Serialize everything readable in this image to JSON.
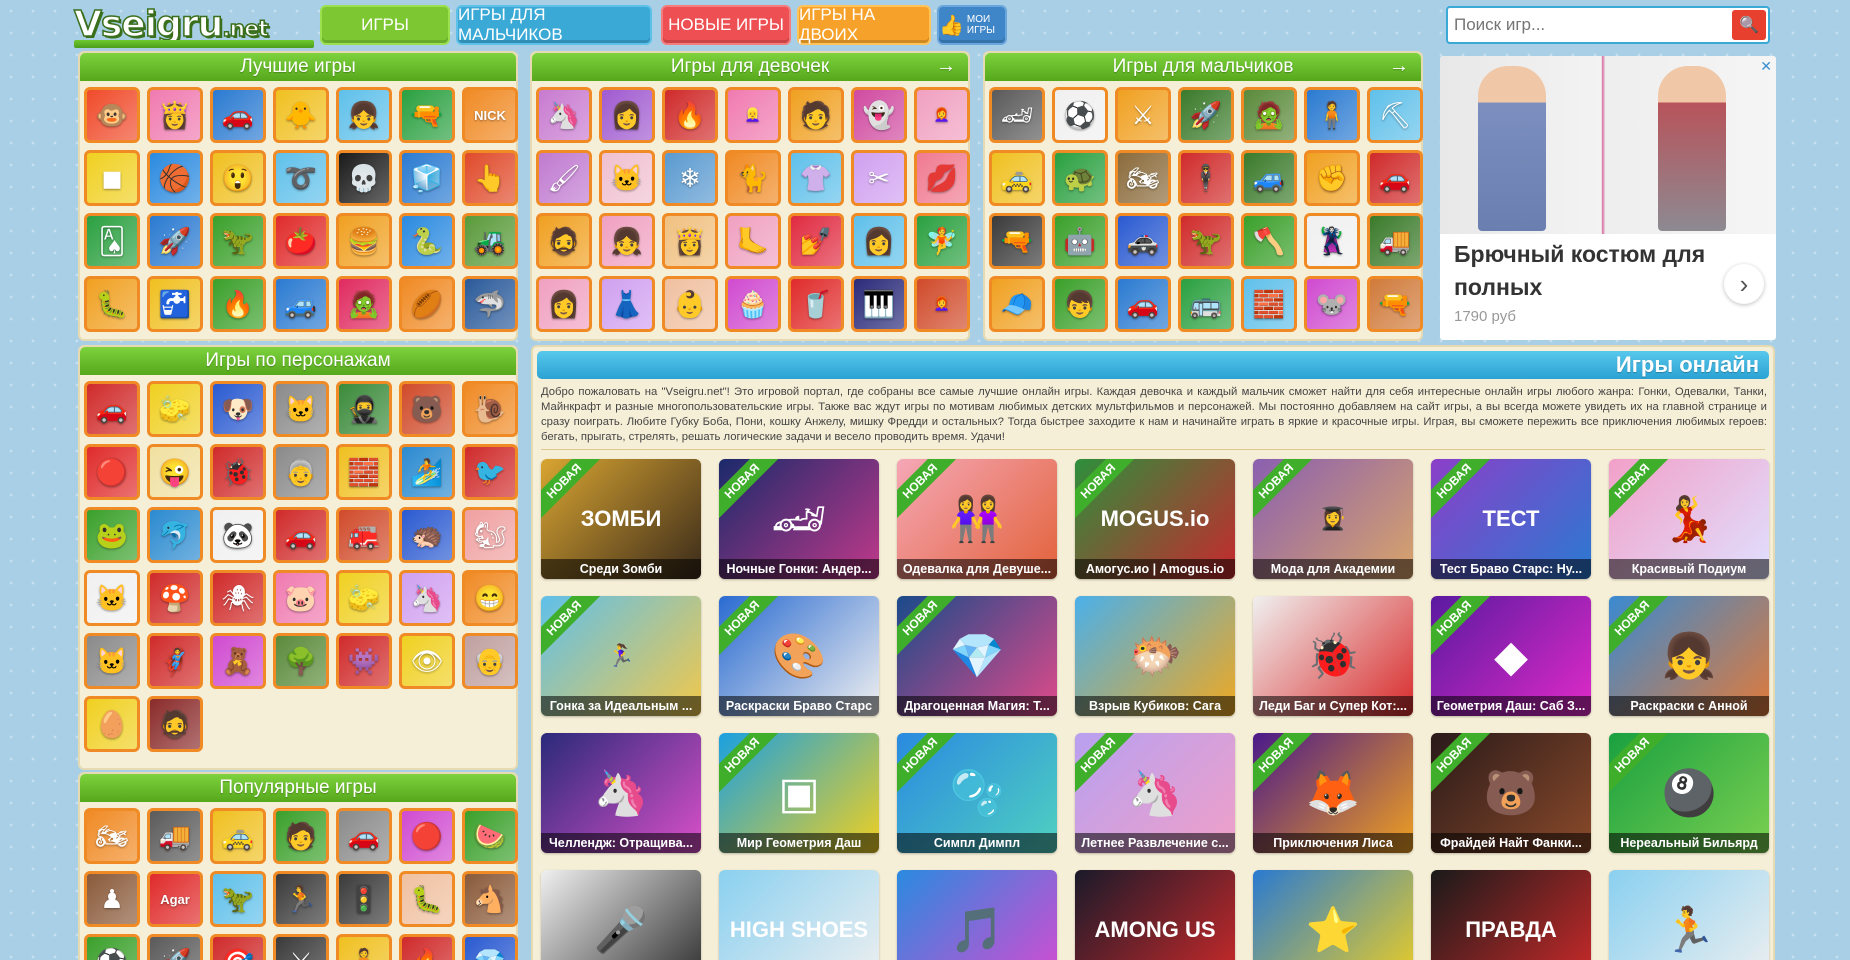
{
  "header": {
    "logo_main": "Vseigru",
    "logo_ext": ".net",
    "nav": {
      "games": "Игры",
      "boys": "Игры для мальчиков",
      "new": "Новые игры",
      "two": "Игры на двоих",
      "mine": "Мои игры"
    },
    "search": {
      "placeholder": "Поиск игр...",
      "icon": "search-icon"
    }
  },
  "panels": {
    "best": {
      "title": "Лучшие игры"
    },
    "girls": {
      "title": "Игры для девочек",
      "arrow": "→"
    },
    "boys": {
      "title": "Игры для мальчиков",
      "arrow": "→"
    },
    "chars": {
      "title": "Игры по персонажам"
    },
    "popular": {
      "title": "Популярные игры"
    }
  },
  "ad": {
    "title": "Брючный костюм для полных",
    "price": "1790 руб",
    "close": "✕",
    "next": "›"
  },
  "online": {
    "title": "Игры онлайн",
    "description": "Добро пожаловать на \"Vseigru.net\"! Это игровой портал, где собраны все самые лучшие онлайн игры. Каждая девочка и каждый мальчик сможет найти для себя интересные онлайн игры любого жанра: Гонки, Одевалки, Танки, Майнкрафт и разные многопользовательские игры. Также вас ждут игры по мотивам любимых детских мультфильмов и персонажей. Мы постоянно добавляем на сайт игры, а вы всегда можете увидеть их на главной странице и сразу поиграть. Любите Губку Боба, Пони, кошку Анжелу, мишку Фредди и остальных? Тогда быстрее заходите к нам и начинайте играть в яркие и красочные игры. Играя, вы сможете пережить все приключения любимых героев: бегать, прыгать, стрелять, решать логические задачи и весело проводить время. Удачи!",
    "new_label": "Новая",
    "cards": [
      {
        "title": "Среди Зомби",
        "art": "ЗОМБИ",
        "new": true,
        "c1": "#d9a531",
        "c2": "#3a2a1a"
      },
      {
        "title": "Ночные Гонки: Андер...",
        "art": "🏎",
        "new": true,
        "c1": "#1b2a6b",
        "c2": "#c0398a"
      },
      {
        "title": "Одевалка для Девуше...",
        "art": "👭",
        "new": true,
        "c1": "#f5a7b6",
        "c2": "#e2623a"
      },
      {
        "title": "Амогус.ио | Amogus.io",
        "art": "MOGUS.io",
        "new": true,
        "c1": "#2d8f3c",
        "c2": "#c8282f"
      },
      {
        "title": "Мода для Академии",
        "art": "👩‍🎓",
        "new": true,
        "c1": "#8a5fb0",
        "c2": "#d9a46a"
      },
      {
        "title": "Тест Браво Старс: Ну...",
        "art": "ТЕСТ",
        "new": true,
        "c1": "#8b3fc9",
        "c2": "#2a7ad1"
      },
      {
        "title": "Красивый Подиум",
        "art": "💃",
        "new": true,
        "c1": "#f2a0c8",
        "c2": "#e0e0ff"
      },
      {
        "title": "Гонка за Идеальным ...",
        "art": "🏃‍♀️",
        "new": true,
        "c1": "#5fc0ea",
        "c2": "#f2c84a"
      },
      {
        "title": "Раскраски Браво Старс",
        "art": "🎨",
        "new": true,
        "c1": "#2a6bd1",
        "c2": "#f0f0f0"
      },
      {
        "title": "Драгоценная Магия: Т...",
        "art": "💎",
        "new": true,
        "c1": "#1a4a8a",
        "c2": "#e04a8a"
      },
      {
        "title": "Взрыв Кубиков: Сага",
        "art": "🐡",
        "new": false,
        "c1": "#4ab0ea",
        "c2": "#f0a820"
      },
      {
        "title": "Леди Баг и Супер Кот:...",
        "art": "🐞",
        "new": false,
        "c1": "#f0f0f0",
        "c2": "#d92a2a"
      },
      {
        "title": "Геометрия Даш: Саб З...",
        "art": "◆",
        "new": true,
        "c1": "#5a1aa0",
        "c2": "#e02ac8"
      },
      {
        "title": "Раскраски с Анной",
        "art": "👧",
        "new": true,
        "c1": "#3a8ad1",
        "c2": "#e07a3a"
      },
      {
        "title": "Челлендж: Отращива...",
        "art": "🦄",
        "new": false,
        "c1": "#2a2a7a",
        "c2": "#d950c8"
      },
      {
        "title": "Мир Геометрия Даш",
        "art": "▣",
        "new": true,
        "c1": "#1aa0e0",
        "c2": "#f0d020"
      },
      {
        "title": "Симпл Димпл",
        "art": "🫧",
        "new": true,
        "c1": "#2a8ae0",
        "c2": "#50d0c0"
      },
      {
        "title": "Летнее Развлечение с...",
        "art": "🦄",
        "new": true,
        "c1": "#b8a0f0",
        "c2": "#f0a0c8"
      },
      {
        "title": "Приключения Лиса",
        "art": "🦊",
        "new": true,
        "c1": "#4a1a8a",
        "c2": "#f0a020"
      },
      {
        "title": "Фрайдей Найт Фанки...",
        "art": "🐻",
        "new": true,
        "c1": "#2a1a1a",
        "c2": "#8a4a2a"
      },
      {
        "title": "Нереальный Бильярд",
        "art": "🎱",
        "new": true,
        "c1": "#1aa040",
        "c2": "#7ad050"
      },
      {
        "title": "",
        "art": "🎤",
        "new": false,
        "c1": "#f0f0f0",
        "c2": "#2a2a2a"
      },
      {
        "title": "",
        "art": "HIGH SHOES",
        "new": false,
        "c1": "#8ad0f0",
        "c2": "#f0f0f0"
      },
      {
        "title": "",
        "art": "🎵",
        "new": false,
        "c1": "#2a8ae0",
        "c2": "#d94ad0"
      },
      {
        "title": "",
        "art": "AMONG US",
        "new": false,
        "c1": "#1a1a2a",
        "c2": "#d02a2a"
      },
      {
        "title": "",
        "art": "⭐",
        "new": false,
        "c1": "#2a7ad1",
        "c2": "#f0d020"
      },
      {
        "title": "",
        "art": "ПРАВДА",
        "new": false,
        "c1": "#1a1a1a",
        "c2": "#d02a2a"
      },
      {
        "title": "",
        "art": "🏃",
        "new": false,
        "c1": "#8ad0f0",
        "c2": "#f0f0f0"
      }
    ]
  },
  "tiles": {
    "best": [
      [
        "🐵",
        "#f04a2a"
      ],
      [
        "👸",
        "#f07ab0"
      ],
      [
        "🚗",
        "#2a7ad1"
      ],
      [
        "🐥",
        "#f0c020"
      ],
      [
        "👧",
        "#5fc0ea"
      ],
      [
        "🔫",
        "#2aa040"
      ],
      [
        "NICK",
        "#f08a24"
      ],
      [
        "◼",
        "#f0d020"
      ],
      [
        "🏀",
        "#2a8ae0"
      ],
      [
        "😲",
        "#f0c020"
      ],
      [
        "➰",
        "#5fc0ea"
      ],
      [
        "💀",
        "#1a1a1a"
      ],
      [
        "🧊",
        "#2a7ad1"
      ],
      [
        "👆",
        "#e04a2a"
      ],
      [
        "🂡",
        "#2aa040"
      ],
      [
        "🚀",
        "#2a7ad1"
      ],
      [
        "🦖",
        "#3aa02a"
      ],
      [
        "🍅",
        "#e02a2a"
      ],
      [
        "🍔",
        "#f0a020"
      ],
      [
        "🐍",
        "#2a8ae0"
      ],
      [
        "🚜",
        "#5a9a3a"
      ],
      [
        "🐛",
        "#f0a020"
      ],
      [
        "🚰",
        "#f0c020"
      ],
      [
        "🔥",
        "#3aa02a"
      ],
      [
        "🚙",
        "#2a7ad1"
      ],
      [
        "🧟",
        "#e02a60"
      ],
      [
        "🏉",
        "#f08a24"
      ],
      [
        "🦈",
        "#2a5a9a"
      ]
    ],
    "girls": [
      [
        "🦄",
        "#c87ad0"
      ],
      [
        "👩",
        "#a05ad0"
      ],
      [
        "🔥",
        "#d02a2a"
      ],
      [
        "👱‍♀️",
        "#f07ab0"
      ],
      [
        "🧑",
        "#f0a020"
      ],
      [
        "👻",
        "#d04aa0"
      ],
      [
        "👩‍🦰",
        "#f0a0c0"
      ],
      [
        "🖌",
        "#c07ad0"
      ],
      [
        "🐱",
        "#f0c0d0"
      ],
      [
        "❄",
        "#5a9ad0"
      ],
      [
        "🐈",
        "#f08a24"
      ],
      [
        "👚",
        "#5fc0ea"
      ],
      [
        "✂",
        "#d0a0f0"
      ],
      [
        "💋",
        "#f07a90"
      ],
      [
        "🧔",
        "#f0a020"
      ],
      [
        "👧",
        "#f0a0c0"
      ],
      [
        "👸",
        "#f0c080"
      ],
      [
        "🦶",
        "#f0a0c0"
      ],
      [
        "💅",
        "#e02a40"
      ],
      [
        "👩",
        "#5fc0ea"
      ],
      [
        "🧚",
        "#2aa040"
      ],
      [
        "👩",
        "#f0a0c0"
      ],
      [
        "👗",
        "#d0a0f0"
      ],
      [
        "👶",
        "#f0c0a0"
      ],
      [
        "🧁",
        "#d04ad0"
      ],
      [
        "🥤",
        "#e02a2a"
      ],
      [
        "🎹",
        "#2a2a7a"
      ],
      [
        "👩‍🦰",
        "#d04a2a"
      ]
    ],
    "boys": [
      [
        "🏎",
        "#5a5a5a"
      ],
      [
        "⚽",
        "#f0f0f0"
      ],
      [
        "⚔",
        "#f0a020"
      ],
      [
        "🚀",
        "#3a7a2a"
      ],
      [
        "🧟",
        "#5a8a3a"
      ],
      [
        "🧍",
        "#2a7ad1"
      ],
      [
        "⛏",
        "#5fc0ea"
      ],
      [
        "🚕",
        "#f0c020"
      ],
      [
        "🐢",
        "#2aa040"
      ],
      [
        "🏍",
        "#8a6a3a"
      ],
      [
        "🕴",
        "#d02a2a"
      ],
      [
        "🚙",
        "#3a7a2a"
      ],
      [
        "✊",
        "#f0a020"
      ],
      [
        "🚗",
        "#d02a2a"
      ],
      [
        "🔫",
        "#3a3a3a"
      ],
      [
        "🤖",
        "#3aa02a"
      ],
      [
        "🚓",
        "#2a5ad1"
      ],
      [
        "🦖",
        "#d02a2a"
      ],
      [
        "🪓",
        "#3aa02a"
      ],
      [
        "🦹",
        "#f0f0f0"
      ],
      [
        "🚚",
        "#3a7a2a"
      ],
      [
        "🧢",
        "#f0a020"
      ],
      [
        "👦",
        "#3aa02a"
      ],
      [
        "🚗",
        "#2a7ad1"
      ],
      [
        "🚌",
        "#2aa040"
      ],
      [
        "🧱",
        "#5fc0ea"
      ],
      [
        "🐭",
        "#d04ad0"
      ],
      [
        "🔫",
        "#d07a3a"
      ]
    ],
    "chars": [
      [
        "🚗",
        "#d02a2a"
      ],
      [
        "🧽",
        "#f0d020"
      ],
      [
        "🐶",
        "#2a5ad1"
      ],
      [
        "🐱",
        "#8a8a8a"
      ],
      [
        "🥷",
        "#3a8a3a"
      ],
      [
        "🐻",
        "#d04a2a"
      ],
      [
        "🐌",
        "#f08a24"
      ],
      [
        "🔴",
        "#e02a2a"
      ],
      [
        "😜",
        "#f0e0a0"
      ],
      [
        "🐞",
        "#d02a2a"
      ],
      [
        "👵",
        "#8a8a8a"
      ],
      [
        "🧱",
        "#f0c020"
      ],
      [
        "🏄",
        "#2a8ad0"
      ],
      [
        "🐦",
        "#d02a2a"
      ],
      [
        "🐸",
        "#3aa02a"
      ],
      [
        "🐬",
        "#2a8ad0"
      ],
      [
        "🐼",
        "#f0f0f0"
      ],
      [
        "🚗",
        "#d02a2a"
      ],
      [
        "🚒",
        "#d04a2a"
      ],
      [
        "🦔",
        "#2a5ad1"
      ],
      [
        "🐿",
        "#f0a0a0"
      ],
      [
        "🐱",
        "#f0f0f0"
      ],
      [
        "🍄",
        "#d02a2a"
      ],
      [
        "🕷",
        "#d02a2a"
      ],
      [
        "🐷",
        "#f07ab0"
      ],
      [
        "🧽",
        "#f0d020"
      ],
      [
        "🦄",
        "#d0a0f0"
      ],
      [
        "😁",
        "#f08a24"
      ],
      [
        "🐱",
        "#8a8a8a"
      ],
      [
        "🦸",
        "#d02a2a"
      ],
      [
        "🧸",
        "#d04ad0"
      ],
      [
        "🌳",
        "#5a8a3a"
      ],
      [
        "👾",
        "#d02a2a"
      ],
      [
        "👁",
        "#f0d020"
      ],
      [
        "👴",
        "#c0a0a0"
      ],
      [
        "🥚",
        "#f0d020"
      ],
      [
        "🧔",
        "#8a2a2a"
      ]
    ],
    "popular": [
      [
        "🏍",
        "#f08a24"
      ],
      [
        "🚚",
        "#5a5a5a"
      ],
      [
        "🚕",
        "#f0c020"
      ],
      [
        "🧑",
        "#3aa02a"
      ],
      [
        "🚗",
        "#8a8a8a"
      ],
      [
        "🔴",
        "#d04ad0"
      ],
      [
        "🍉",
        "#3aa02a"
      ],
      [
        "♟",
        "#8a5a3a"
      ],
      [
        "Agar",
        "#e02a2a"
      ],
      [
        "🦖",
        "#5fc0ea"
      ],
      [
        "🏃",
        "#3a3a3a"
      ],
      [
        "🚦",
        "#3a3a3a"
      ],
      [
        "🐛",
        "#f0c0a0"
      ],
      [
        "🐴",
        "#8a5a3a"
      ],
      [
        "⚽",
        "#3aa02a"
      ],
      [
        "🚀",
        "#5a5a5a"
      ],
      [
        "🎯",
        "#d02a2a"
      ],
      [
        "⚔",
        "#3a3a3a"
      ],
      [
        "🧍",
        "#f0c020"
      ],
      [
        "🔥",
        "#d02a2a"
      ],
      [
        "💎",
        "#2a5ad1"
      ]
    ]
  },
  "colors": {
    "accent_green": "#7dc832",
    "accent_blue": "#3aa9d6",
    "accent_red": "#ee4f52",
    "accent_orange": "#f6a22a",
    "tile_border": "#f08a24"
  }
}
